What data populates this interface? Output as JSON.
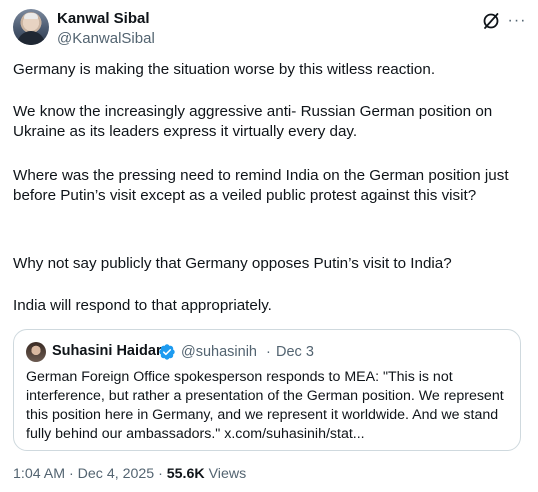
{
  "author": {
    "name": "Kanwal Sibal",
    "handle": "@KanwalSibal"
  },
  "header_icons": [
    "grok-icon",
    "more-icon"
  ],
  "more_glyph": "···",
  "tweet": {
    "paragraphs": [
      "Germany is making the situation worse by this witless reaction.",
      "We know the increasingly aggressive  anti- Russian German position on Ukraine as its leaders express it virtually every day.",
      "Where was the pressing need to remind India on the German position just before Putin’s visit except as a veiled public protest against this visit?",
      "Why not say publicly that Germany opposes Putin’s visit to India?",
      "India will respond to that appropriately."
    ]
  },
  "quoted": {
    "name": "Suhasini Haidar",
    "handle": "@suhasinih",
    "separator": "·",
    "date": "Dec 3",
    "verified": true,
    "text": "German Foreign Office spokesperson responds to MEA: \"This is not interference, but rather a presentation of the German position. We represent this position here in Germany, and we represent it worldwide. And we stand fully behind our ambassadors.\" x.com/suhasinih/stat..."
  },
  "meta": {
    "time_date": "1:04 AM · Dec 4, 2025 · ",
    "views_count": "55.6K",
    "views_label": " Views"
  },
  "colors": {
    "text": "#0f1419",
    "secondary": "#536471",
    "border": "#cfd9de",
    "verified": "#1d9bf0"
  }
}
